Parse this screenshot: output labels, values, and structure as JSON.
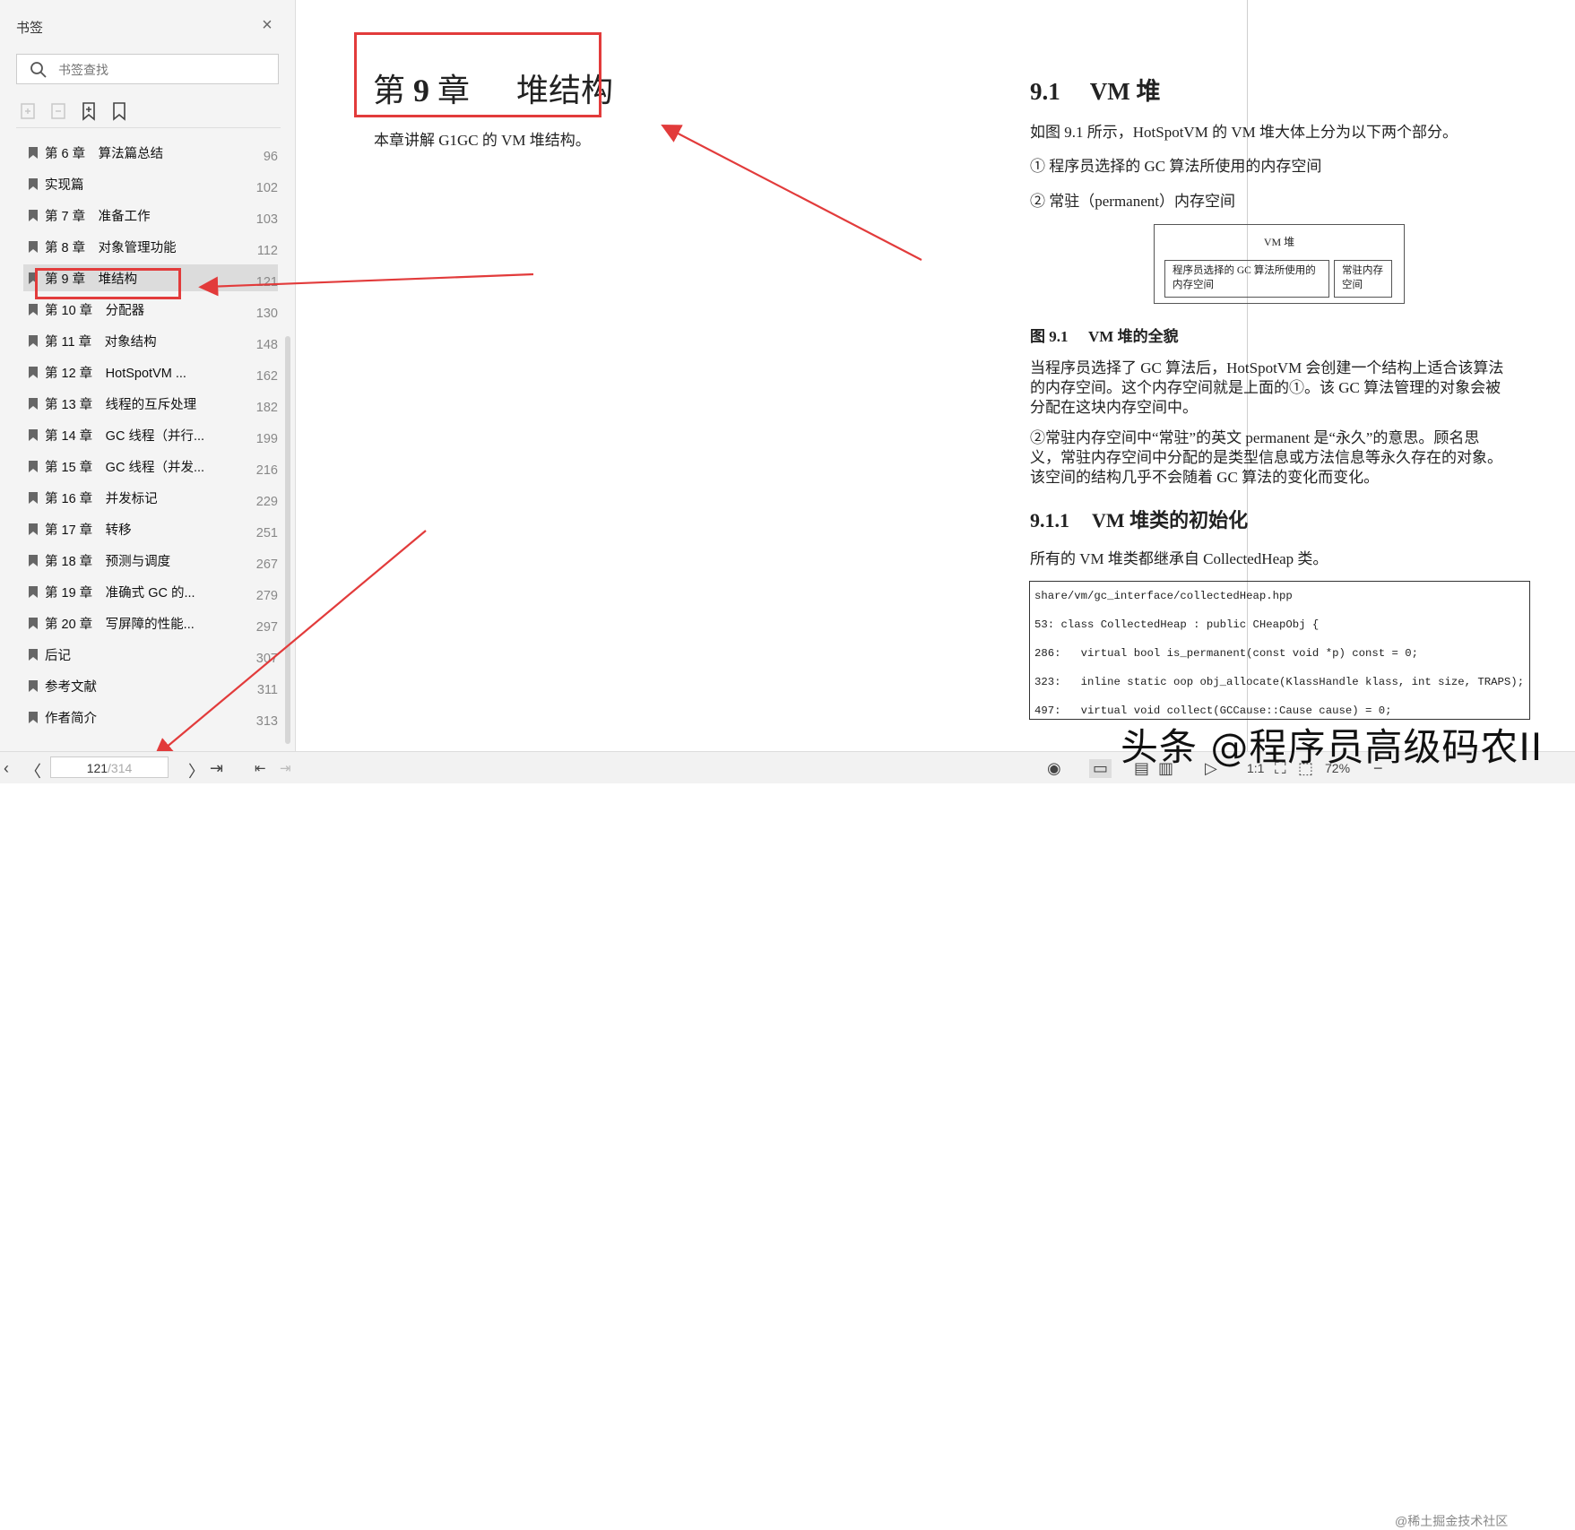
{
  "sidebar": {
    "title": "书签",
    "search_placeholder": "书签查找",
    "items": [
      {
        "label": "第 6 章　算法篇总结",
        "page": "96"
      },
      {
        "label": "实现篇",
        "page": "102"
      },
      {
        "label": "第 7 章　准备工作",
        "page": "103"
      },
      {
        "label": "第 8 章　对象管理功能",
        "page": "112"
      },
      {
        "label": "第 9 章　堆结构",
        "page": "121"
      },
      {
        "label": "第 10 章　分配器",
        "page": "130"
      },
      {
        "label": "第 11 章　对象结构",
        "page": "148"
      },
      {
        "label": "第 12 章　HotSpotVM ...",
        "page": "162"
      },
      {
        "label": "第 13 章　线程的互斥处理",
        "page": "182"
      },
      {
        "label": "第 14 章　GC 线程（并行...",
        "page": "199"
      },
      {
        "label": "第 15 章　GC 线程（并发...",
        "page": "216"
      },
      {
        "label": "第 16 章　并发标记",
        "page": "229"
      },
      {
        "label": "第 17 章　转移",
        "page": "251"
      },
      {
        "label": "第 18 章　预测与调度",
        "page": "267"
      },
      {
        "label": "第 19 章　准确式 GC 的...",
        "page": "279"
      },
      {
        "label": "第 20 章　写屏障的性能...",
        "page": "297"
      },
      {
        "label": "后记",
        "page": "307"
      },
      {
        "label": "参考文献",
        "page": "311"
      },
      {
        "label": "作者简介",
        "page": "313"
      }
    ],
    "active_index": 4
  },
  "left_page": {
    "chapter_prefix": "第",
    "chapter_num": "9",
    "chapter_suffix": "章",
    "chapter_title": "堆结构",
    "intro": "本章讲解 G1GC 的 VM 堆结构。"
  },
  "right_page": {
    "section_num": "9.1",
    "section_title": "VM 堆",
    "p1": "如图 9.1 所示，HotSpotVM 的 VM 堆大体上分为以下两个部分。",
    "item1": "① 程序员选择的 GC 算法所使用的内存空间",
    "item2": "② 常驻（permanent）内存空间",
    "figure": {
      "outer": "VM 堆",
      "box1_line1": "程序员选择的 GC 算法所使用的",
      "box1_line2": "内存空间",
      "box2_line1": "常驻内存",
      "box2_line2": "空间",
      "caption_num": "图 9.1",
      "caption_text": "VM 堆的全貌"
    },
    "p2_line1": "当程序员选择了 GC 算法后，HotSpotVM 会创建一个结构上适合该算法",
    "p2_line2": "的内存空间。这个内存空间就是上面的①。该 GC 算法管理的对象会被",
    "p2_line3": "分配在这块内存空间中。",
    "p3_line1": "②常驻内存空间中“常驻”的英文 permanent 是“永久”的意思。顾名思",
    "p3_line2": "义，常驻内存空间中分配的是类型信息或方法信息等永久存在的对象。",
    "p3_line3": "该空间的结构几乎不会随着 GC 算法的变化而变化。",
    "subsection_num": "9.1.1",
    "subsection_title": "VM 堆类的初始化",
    "p4": "所有的 VM 堆类都继承自 CollectedHeap 类。",
    "code": {
      "file": "share/vm/gc_interface/collectedHeap.hpp",
      "lines": [
        "53: class CollectedHeap : public CHeapObj {",
        "286:   virtual bool is_permanent(const void *p) const = 0;",
        "323:   inline static oop obj_allocate(KlassHandle klass, int size, TRAPS);",
        "497:   virtual void collect(GCCause::Cause cause) = 0;"
      ]
    }
  },
  "bottombar": {
    "current_page": "121",
    "total_pages": "/314",
    "zoom": "72%"
  },
  "watermark": {
    "main": "头条 @程序员高级码农II",
    "sub": "@稀土掘金技术社区"
  },
  "colors": {
    "annotation_red": "#e23b3b"
  }
}
